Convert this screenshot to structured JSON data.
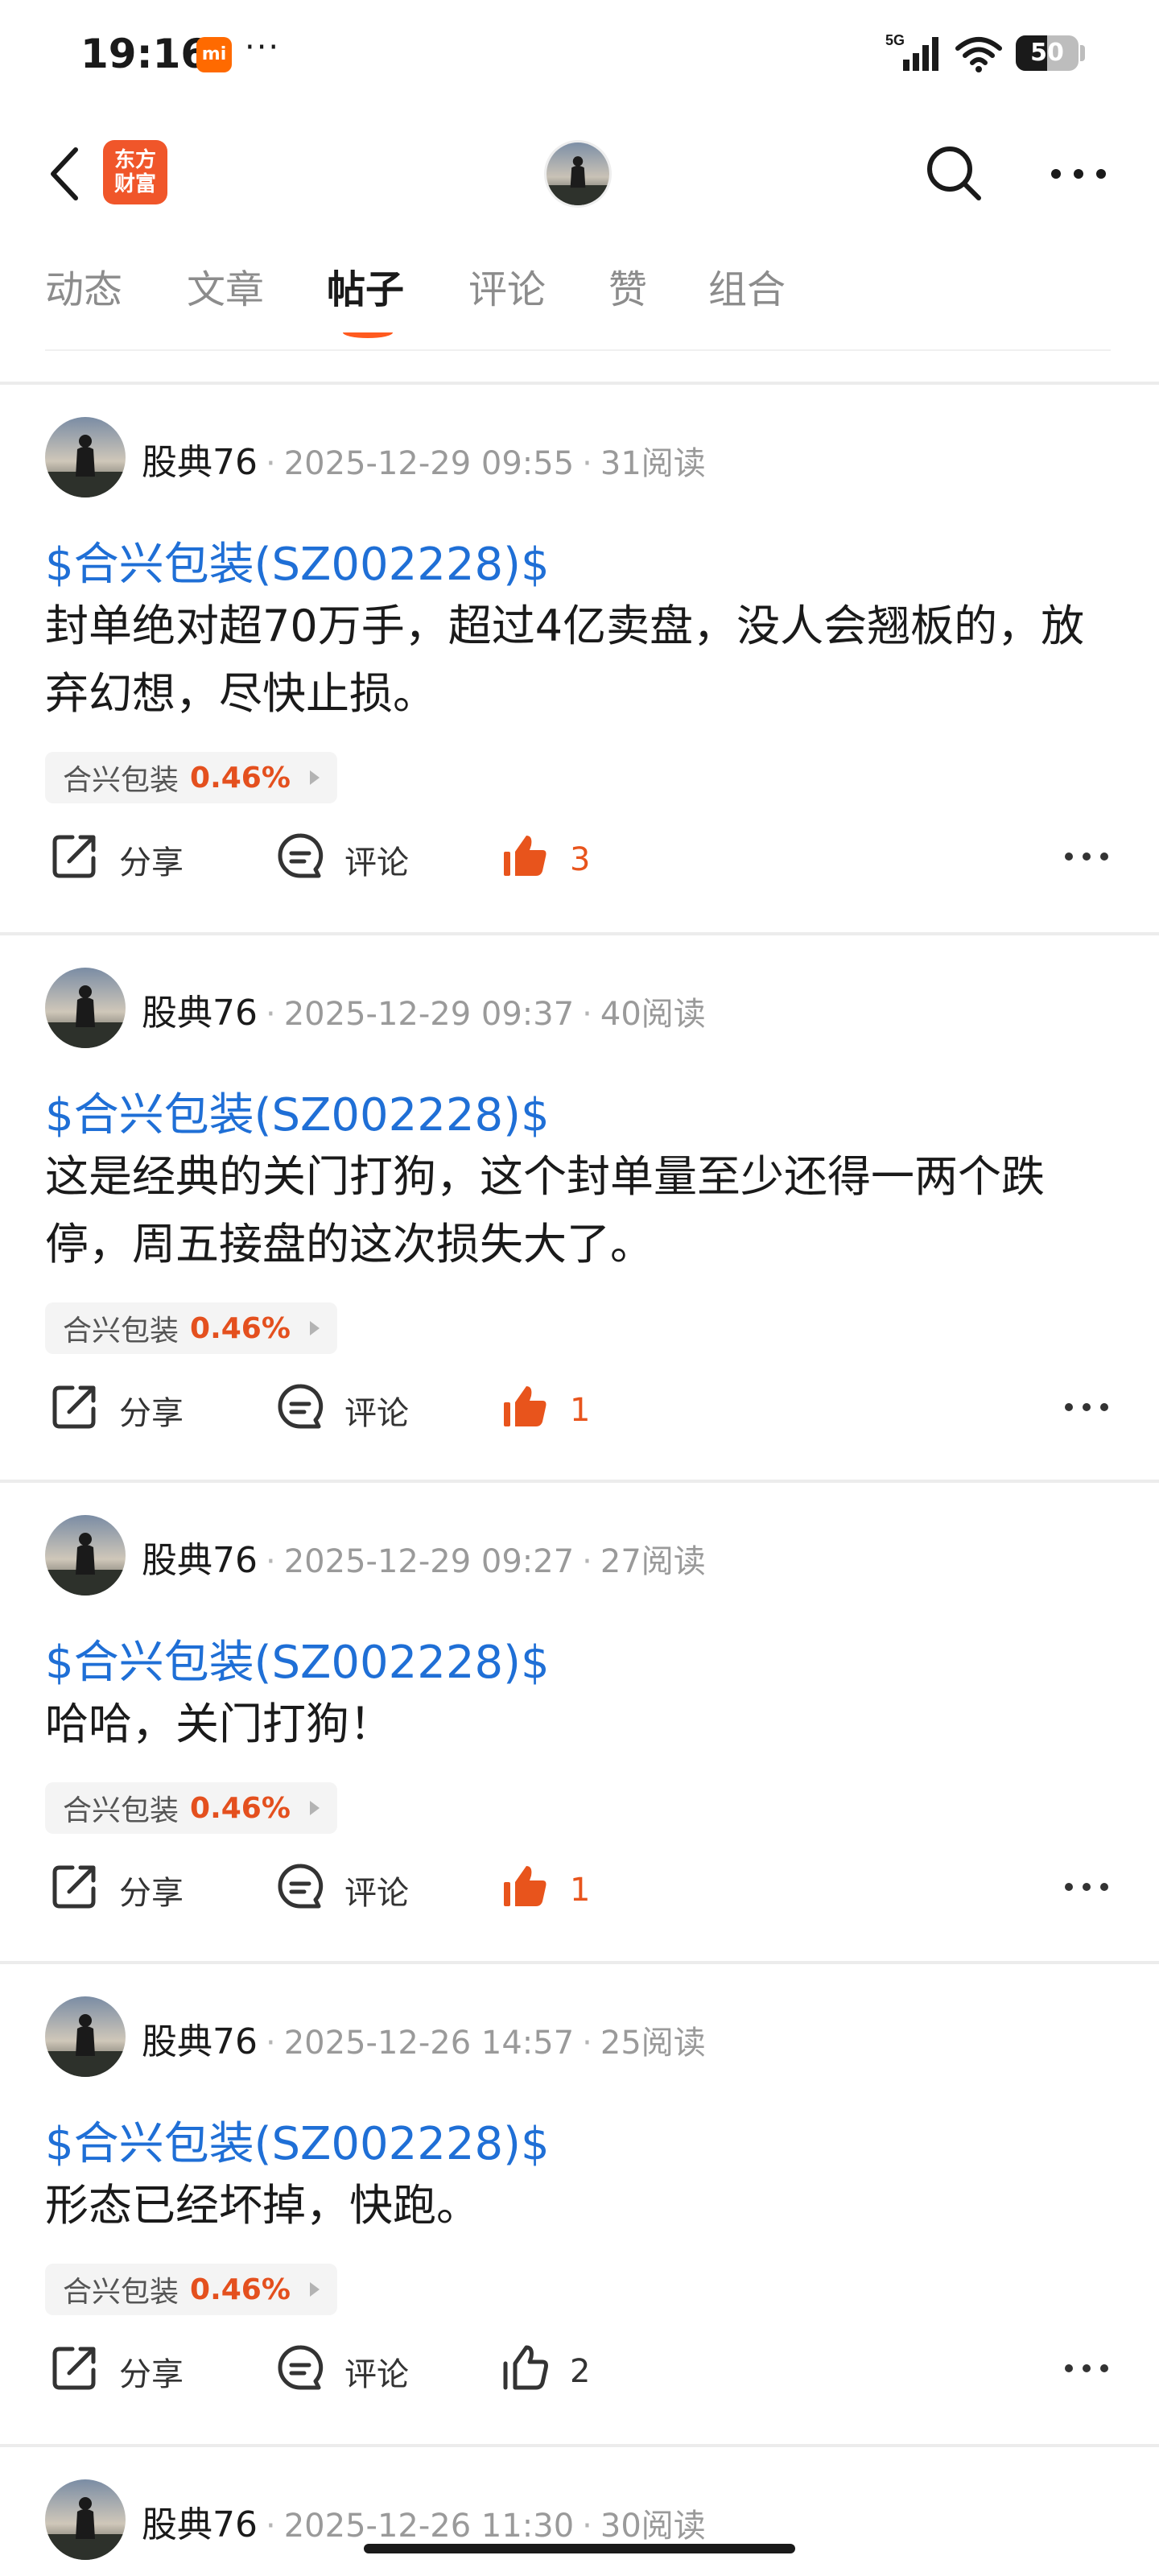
{
  "status_bar": {
    "time": "19:16",
    "app_badge": "mi",
    "dots": "···",
    "network": "5G",
    "battery": "50",
    "battery_level_percent": 50
  },
  "header": {
    "brand_line1": "东方",
    "brand_line2": "财富"
  },
  "tabs": [
    "动态",
    "文章",
    "帖子",
    "评论",
    "赞",
    "组合"
  ],
  "active_tab": "帖子",
  "posts": [
    {
      "author": "股典76",
      "time": "2025-12-29 09:55",
      "reads": "31阅读",
      "stock_link": "$合兴包装(SZ002228)$",
      "content": "封单绝对超70万手，超过4亿卖盘，没人会翘板的，放弃幻想，尽快止损。",
      "tag_name": "合兴包装",
      "tag_change": "0.46%",
      "share_label": "分享",
      "comment_label": "评论",
      "likes": "3",
      "liked": true
    },
    {
      "author": "股典76",
      "time": "2025-12-29 09:37",
      "reads": "40阅读",
      "stock_link": "$合兴包装(SZ002228)$",
      "content": "这是经典的关门打狗，这个封单量至少还得一两个跌停，周五接盘的这次损失大了。",
      "tag_name": "合兴包装",
      "tag_change": "0.46%",
      "share_label": "分享",
      "comment_label": "评论",
      "likes": "1",
      "liked": true
    },
    {
      "author": "股典76",
      "time": "2025-12-29 09:27",
      "reads": "27阅读",
      "stock_link": "$合兴包装(SZ002228)$",
      "content": "哈哈，关门打狗！",
      "tag_name": "合兴包装",
      "tag_change": "0.46%",
      "share_label": "分享",
      "comment_label": "评论",
      "likes": "1",
      "liked": true
    },
    {
      "author": "股典76",
      "time": "2025-12-26 14:57",
      "reads": "25阅读",
      "stock_link": "$合兴包装(SZ002228)$",
      "content": "形态已经坏掉，快跑。",
      "tag_name": "合兴包装",
      "tag_change": "0.46%",
      "share_label": "分享",
      "comment_label": "评论",
      "likes": "2",
      "liked": false
    },
    {
      "author": "股典76",
      "time": "2025-12-26 11:30",
      "reads": "30阅读"
    }
  ],
  "colors": {
    "accent": "#ff5a1f",
    "link": "#1f6fd6",
    "up": "#e4501e",
    "brand": "#f0562a"
  }
}
